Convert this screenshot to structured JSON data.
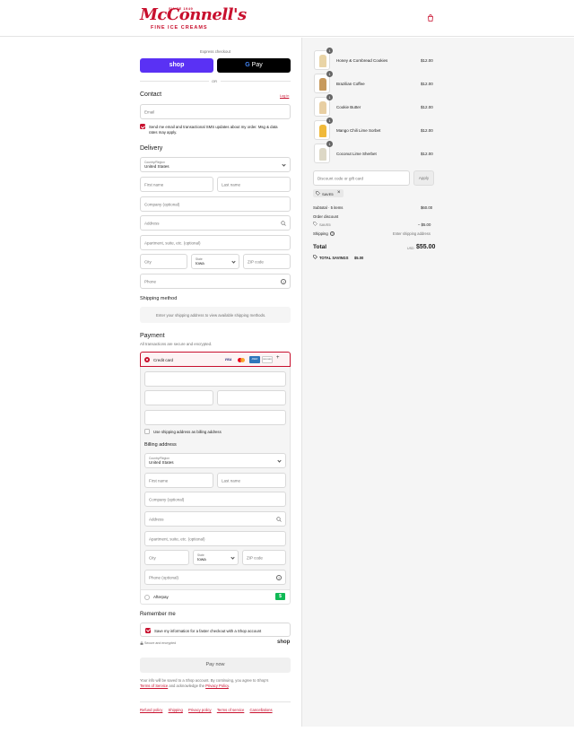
{
  "brand": {
    "since": "SINCE 1949",
    "name": "McConnell's",
    "tagline": "FINE ICE CREAMS"
  },
  "express": {
    "label": "Express checkout",
    "shop_label": "shop",
    "gpay_label": "Pay",
    "or_label": "OR"
  },
  "contact": {
    "title": "Contact",
    "login_link": "Log in",
    "email_placeholder": "Email",
    "marketing_text_1": "Send me email and transactional SMS updates about my order. Msg & data",
    "marketing_text_2": "rates may apply."
  },
  "delivery": {
    "title": "Delivery",
    "country_label": "Country/Region",
    "country_value": "United States",
    "first_name": "First name",
    "last_name": "Last name",
    "company": "Company (optional)",
    "address": "Address",
    "apartment": "Apartment, suite, etc. (optional)",
    "city": "City",
    "state_label": "State",
    "state_value": "Iowa",
    "zip": "ZIP code",
    "phone": "Phone"
  },
  "shipping_method": {
    "title": "Shipping method",
    "notice": "Enter your shipping address to view available shipping methods."
  },
  "payment": {
    "title": "Payment",
    "subtitle": "All transactions are secure and encrypted.",
    "credit_card_label": "Credit card",
    "card_brands": [
      "VISA",
      "MC",
      "AMEX",
      "DISCOVER"
    ],
    "more_cards": "+",
    "use_shipping_billing": "Use shipping address as billing address",
    "billing_title": "Billing address",
    "billing_phone": "Phone (optional)",
    "afterpay_label": "Afterpay",
    "afterpay_badge": "$"
  },
  "remember": {
    "title": "Remember me",
    "save_info": "Save my information for a faster checkout with a Shop account",
    "secure": "Secure and encrypted",
    "shop_logo": "shop"
  },
  "pay_button": "Pay now",
  "terms": {
    "line1": "Your info will be saved to a Shop account. By continuing, you agree to Shop's",
    "tos": "Terms of Service",
    "middle": "and acknowledge the",
    "privacy": "Privacy Policy",
    "end": "."
  },
  "footer_links": [
    "Refund policy",
    "Shipping",
    "Privacy policy",
    "Terms of service",
    "Cancellations"
  ],
  "cart": {
    "items": [
      {
        "name": "Honey & Cornbread Cookies",
        "price": "$12.00",
        "qty": "1",
        "color": "#e9d4a6"
      },
      {
        "name": "Brazilian Coffee",
        "price": "$12.00",
        "qty": "1",
        "color": "#c79a5d"
      },
      {
        "name": "Cookie Butter",
        "price": "$12.00",
        "qty": "1",
        "color": "#e8cfa3"
      },
      {
        "name": "Mango Chili Lime Sorbet",
        "price": "$12.00",
        "qty": "1",
        "color": "#f0b93a"
      },
      {
        "name": "Coconut Lime Sherbet",
        "price": "$12.00",
        "qty": "1",
        "color": "#ddd8c6"
      }
    ],
    "discount_placeholder": "Discount code or gift card",
    "apply_label": "Apply",
    "discount_tag": "SAVE5",
    "subtotal_label": "Subtotal · 5 items",
    "subtotal_value": "$60.00",
    "order_discount_label": "Order discount",
    "discount_code": "SAVE5",
    "discount_value": "– $5.00",
    "shipping_label": "Shipping",
    "shipping_value": "Enter shipping address",
    "total_label": "Total",
    "currency": "USD",
    "total_value": "$55.00",
    "total_savings_label": "TOTAL SAVINGS",
    "total_savings_value": "$5.00"
  }
}
